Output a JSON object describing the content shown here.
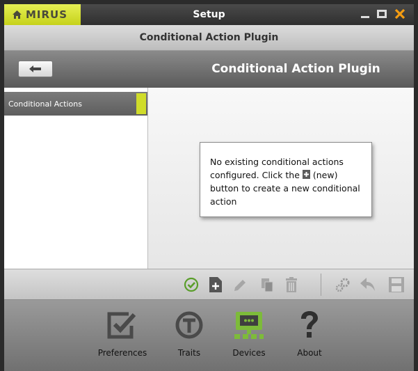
{
  "window": {
    "brand": "MIRUS",
    "title": "Setup"
  },
  "subtitle": "Conditional Action Plugin",
  "header": {
    "title": "Conditional Action Plugin"
  },
  "sidebar": {
    "items": [
      {
        "label": "Conditional Actions",
        "selected": true
      }
    ]
  },
  "main": {
    "message_before": "No existing conditional actions configured.  Click the",
    "message_after": "(new) button to create a new conditional action"
  },
  "toolbar": {
    "buttons": [
      "apply-icon",
      "new-icon",
      "edit-icon",
      "copy-icon",
      "delete-icon",
      "settings-icon",
      "undo-icon",
      "save-icon"
    ]
  },
  "nav": {
    "items": [
      {
        "label": "Preferences",
        "icon": "preferences-icon"
      },
      {
        "label": "Traits",
        "icon": "traits-icon"
      },
      {
        "label": "Devices",
        "icon": "devices-icon"
      },
      {
        "label": "About",
        "icon": "about-icon"
      }
    ]
  },
  "colors": {
    "accent": "#c6d21a",
    "close": "#f39c12",
    "devices_green": "#7dbb3a",
    "apply_green": "#5a9e2a"
  }
}
